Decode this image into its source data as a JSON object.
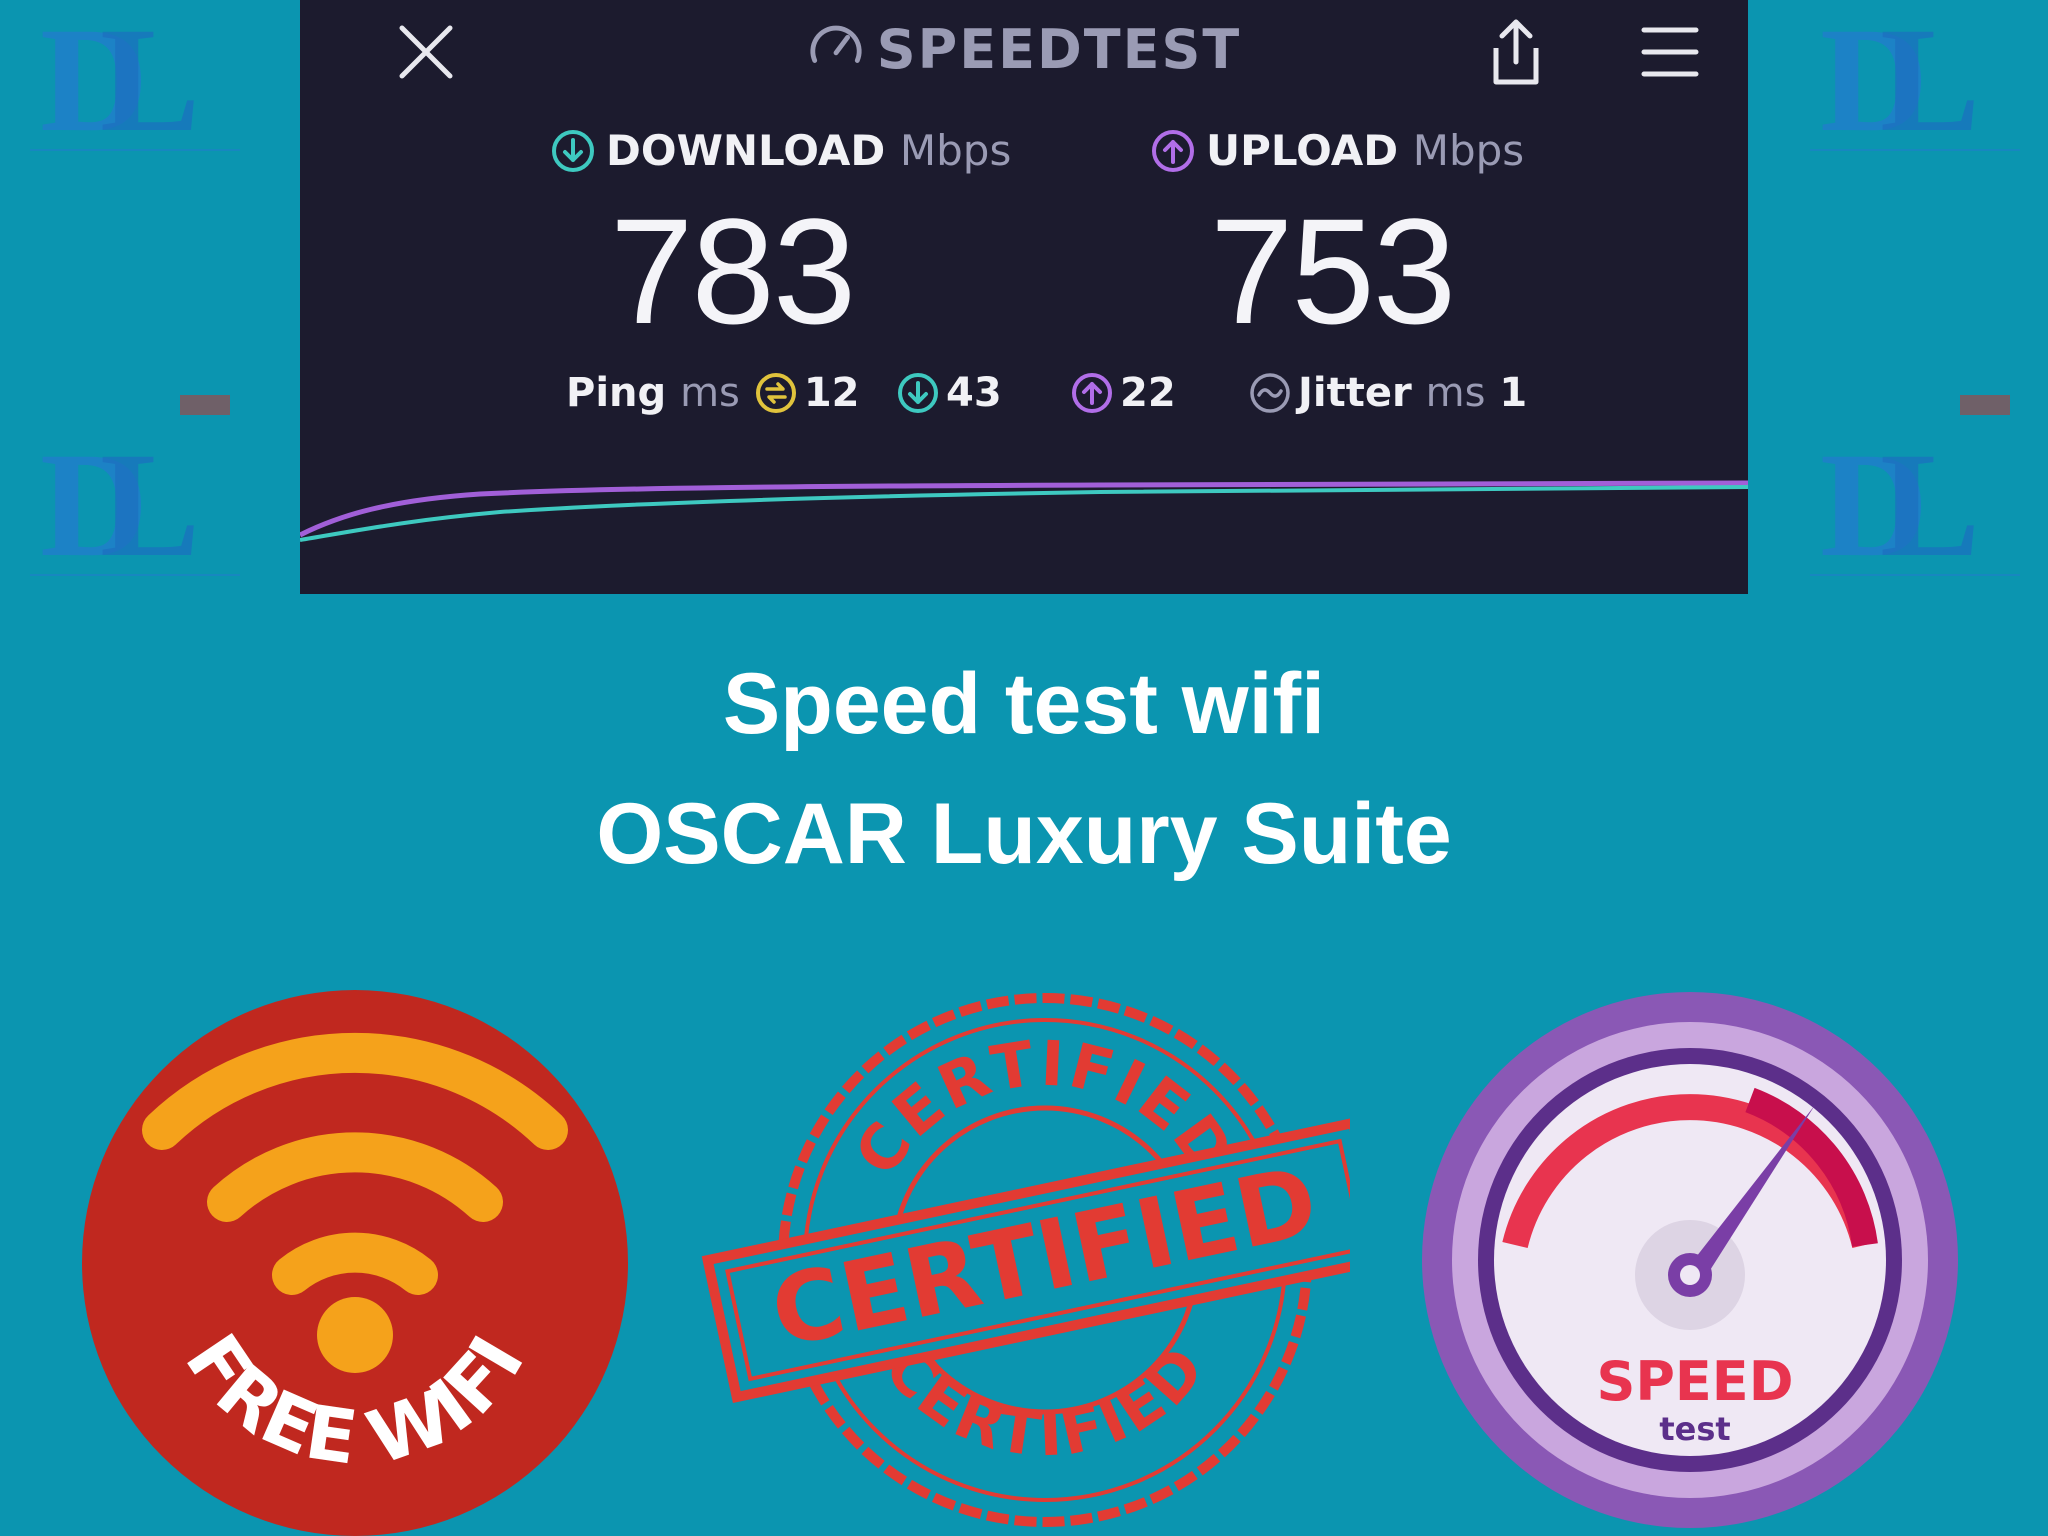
{
  "speedtest": {
    "brand": "SPEEDTEST",
    "download": {
      "label": "DOWNLOAD",
      "unit": "Mbps",
      "value": "783"
    },
    "upload": {
      "label": "UPLOAD",
      "unit": "Mbps",
      "value": "753"
    },
    "ping": {
      "label": "Ping",
      "unit": "ms",
      "idle": "12",
      "download": "43",
      "upload": "22"
    },
    "jitter": {
      "label": "Jitter",
      "unit": "ms",
      "value": "1"
    },
    "icons": {
      "close": "close-icon",
      "share": "share-icon",
      "menu": "menu-icon"
    },
    "colors": {
      "download": "#3ec9c0",
      "upload": "#b16ee8",
      "ping": "#e0c33c"
    }
  },
  "caption": {
    "line1": "Speed test wifi",
    "line2": "OSCAR Luxury Suite"
  },
  "badges": {
    "free_wifi": "FREE WIFI",
    "certified_main": "CERTIFIED",
    "certified_top": "CERTIFIED",
    "certified_bottom": "CERTIFIED",
    "speed_title": "SPEED",
    "speed_sub": "test"
  },
  "watermark": {
    "logo_letters": "DL"
  },
  "colors": {
    "background": "#0b95b0",
    "card": "#1c1b2e",
    "wifi_red": "#c0281f",
    "wifi_orange": "#f5a21b",
    "stamp_red": "#e23b33",
    "speed_purple": "#8a58b5"
  }
}
